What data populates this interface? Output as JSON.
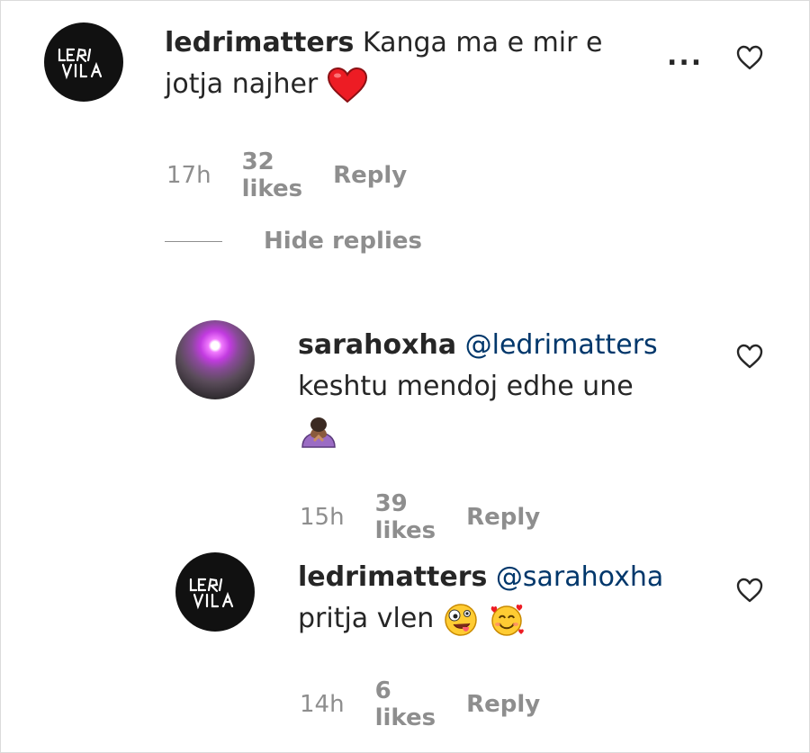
{
  "comments": [
    {
      "username": "ledrimatters",
      "mention": "",
      "line1": "Kanga ma e mir e",
      "line2": "jotja najher",
      "emoji": "red-heart",
      "time": "17h",
      "likes": "32 likes",
      "reply": "Reply",
      "more": "..."
    },
    {
      "username": "sarahoxha",
      "mention": "@ledrimatters",
      "line1": "keshtu mendoj edhe une",
      "emoji": "person-bowing",
      "time": "15h",
      "likes": "39 likes",
      "reply": "Reply"
    },
    {
      "username": "ledrimatters",
      "mention": "@sarahoxha",
      "line1": "pritja vlen",
      "emoji": "zany-face,smiling-face-with-hearts",
      "time": "14h",
      "likes": "6 likes",
      "reply": "Reply"
    }
  ],
  "hide_replies": "Hide replies",
  "colors": {
    "mention": "#00376b",
    "meta": "#8e8e8e",
    "text": "#262626",
    "heart_emoji": "#ed1c24"
  },
  "icons": [
    "heart-outline-icon",
    "more-options-icon"
  ]
}
